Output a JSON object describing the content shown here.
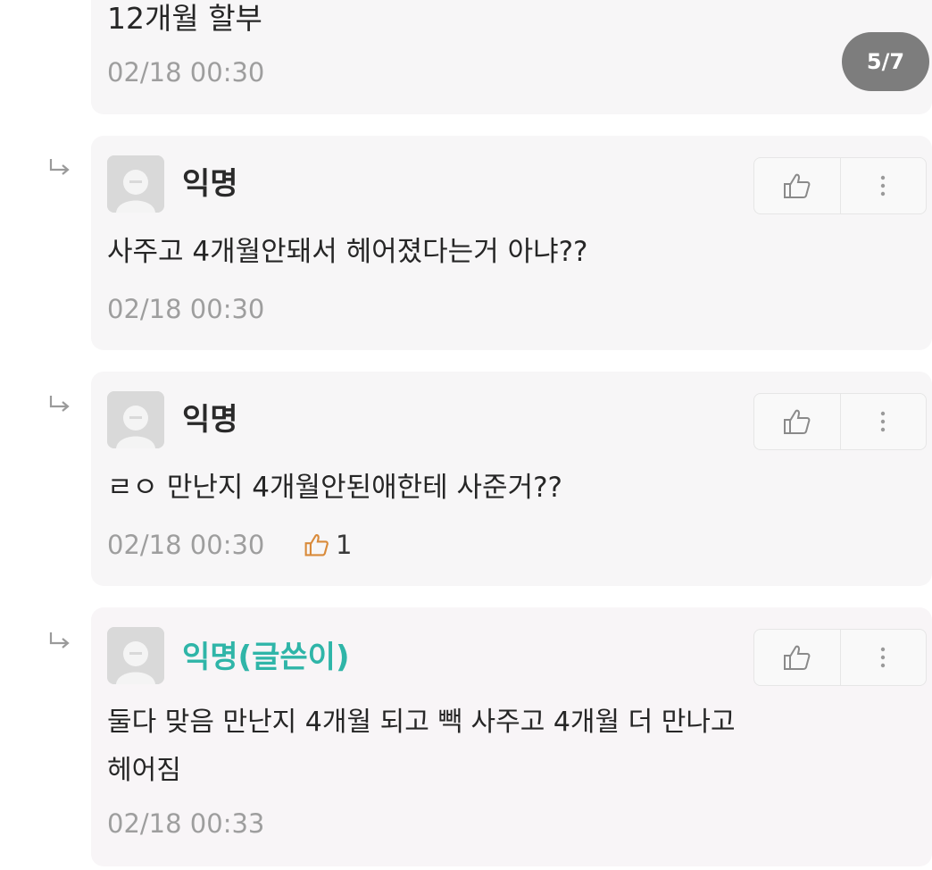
{
  "page_indicator": "5/7",
  "top_partial": {
    "text": "12개월 할부",
    "time": "02/18 00:30"
  },
  "comments": [
    {
      "author": "익명",
      "text": "사주고 4개월안돼서 헤어졌다는거 아냐??",
      "time": "02/18 00:30"
    },
    {
      "author": "익명",
      "text": "ㄹㅇ 만난지 4개월안된애한테 사준거??",
      "time": "02/18 00:30",
      "likes": "1"
    },
    {
      "author": "익명(글쓴이)",
      "text": "둘다 맞음 만난지 4개월 되고 빽 사주고 4개월 더 만나고\n헤어짐",
      "time": "02/18 00:33"
    }
  ],
  "icons": {
    "reply": "reply-arrow-icon",
    "avatar": "default-avatar-icon",
    "like": "thumbs-up-icon",
    "more": "more-vertical-icon"
  },
  "colors": {
    "op_author": "#2fb5a8",
    "timestamp": "#9e9e9e",
    "card_bg": "#f7f6f7",
    "indicator_bg": "#7d7d7d"
  }
}
